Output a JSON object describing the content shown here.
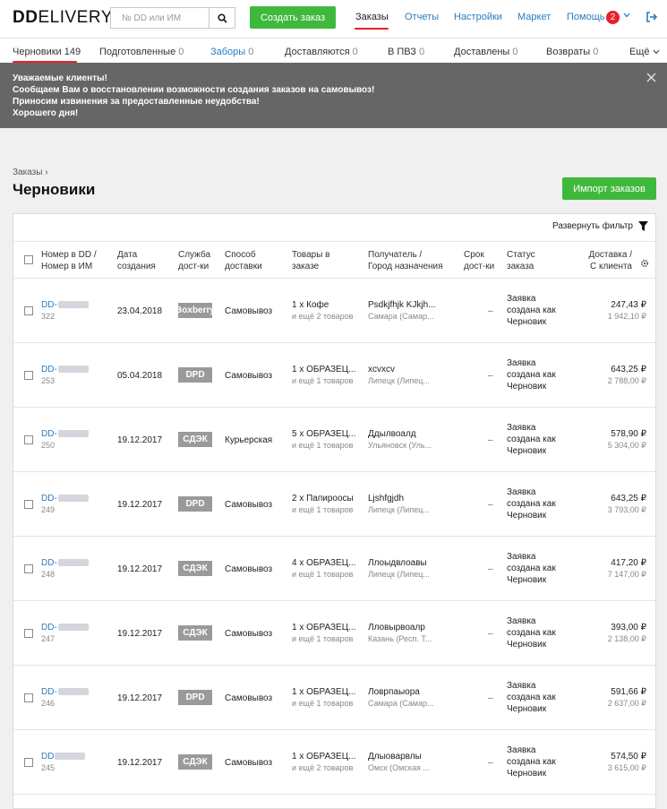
{
  "header": {
    "logo_bold": "DD",
    "logo_rest": "ELIVERY",
    "search_placeholder": "№ DD или ИМ",
    "create_label": "Создать заказ",
    "nav": [
      {
        "label": "Заказы",
        "active": true
      },
      {
        "label": "Отчеты"
      },
      {
        "label": "Настройки"
      },
      {
        "label": "Маркет"
      },
      {
        "label": "Помощь"
      }
    ],
    "help_badge": "2",
    "accent": "#3fb93c",
    "alert_color": "#e8202a",
    "link_color": "#2a7dbf"
  },
  "status_tabs": [
    {
      "label": "Черновики",
      "count": "149"
    },
    {
      "label": "Подготовленные",
      "count": "0"
    },
    {
      "label": "Заборы",
      "count": "0"
    },
    {
      "label": "Доставляются",
      "count": "0"
    },
    {
      "label": "В ПВЗ",
      "count": "0"
    },
    {
      "label": "Доставлены",
      "count": "0"
    },
    {
      "label": "Возвраты",
      "count": "0"
    },
    {
      "label": "Ещё",
      "count": ""
    }
  ],
  "banner": {
    "lines": [
      "Уважаемые клиенты!",
      "Сообщаем Вам о восстановлении возможности создания заказов на самовывоз!",
      "Приносим извинения за предоставленные неудобства!",
      "Хорошего дня!"
    ]
  },
  "page": {
    "breadcrumb": "Заказы",
    "title": "Черновики",
    "import_label": "Импорт заказов",
    "filter_label": "Развернуть фильтр"
  },
  "table": {
    "columns": [
      "Номер в DD /\nНомер в ИМ",
      "Дата\nсоздания",
      "Служба\nдост-ки",
      "Способ\nдоставки",
      "Товары в\nзаказе",
      "Получатель /\nГород назначения",
      "Срок\nдост-ки",
      "Статус\nзаказа",
      "Доставка /\nС клиента"
    ],
    "rows": [
      {
        "dd": "DD-",
        "im": "322",
        "date": "23.04.2018",
        "service": "Boxberry",
        "method": "Самовывоз",
        "goods": "1 x Кофе",
        "goods_more": "и ещё 2 товаров",
        "recipient": "Psdkjfhjk KJkjh...",
        "city": "Самара (Самар...",
        "term": "–",
        "status": "Заявка\nсоздана как\nЧерновик",
        "delivery": "247,43 ₽",
        "client": "1 942,10 ₽"
      },
      {
        "dd": "DD-",
        "im": "253",
        "date": "05.04.2018",
        "service": "DPD",
        "method": "Самовывоз",
        "goods": "1 x ОБРАЗЕЦ...",
        "goods_more": "и ещё 1 товаров",
        "recipient": "xcvxcv",
        "city": "Липецк (Липец...",
        "term": "–",
        "status": "Заявка\nсоздана как\nЧерновик",
        "delivery": "643,25 ₽",
        "client": "2 788,00 ₽"
      },
      {
        "dd": "DD-",
        "im": "250",
        "date": "19.12.2017",
        "service": "СДЭК",
        "method": "Курьерская",
        "goods": "5 x ОБРАЗЕЦ...",
        "goods_more": "и ещё 1 товаров",
        "recipient": "Ддылвоалд",
        "city": "Ульяновск (Уль...",
        "term": "–",
        "status": "Заявка\nсоздана как\nЧерновик",
        "delivery": "578,90 ₽",
        "client": "5 304,00 ₽"
      },
      {
        "dd": "DD-",
        "im": "249",
        "date": "19.12.2017",
        "service": "DPD",
        "method": "Самовывоз",
        "goods": "2 x Папироосы",
        "goods_more": "и ещё 1 товаров",
        "recipient": "Ljshfgjdh",
        "city": "Липецк (Липец...",
        "term": "–",
        "status": "Заявка\nсоздана как\nЧерновик",
        "delivery": "643,25 ₽",
        "client": "3 793,00 ₽"
      },
      {
        "dd": "DD-",
        "im": "248",
        "date": "19.12.2017",
        "service": "СДЭК",
        "method": "Самовывоз",
        "goods": "4 x ОБРАЗЕЦ...",
        "goods_more": "и ещё 1 товаров",
        "recipient": "Ллоыдвлоавы",
        "city": "Липецк (Липец...",
        "term": "–",
        "status": "Заявка\nсоздана как\nЧерновик",
        "delivery": "417,20 ₽",
        "client": "7 147,00 ₽"
      },
      {
        "dd": "DD-",
        "im": "247",
        "date": "19.12.2017",
        "service": "СДЭК",
        "method": "Самовывоз",
        "goods": "1 x ОБРАЗЕЦ...",
        "goods_more": "и ещё 1 товаров",
        "recipient": "Лловырвоалр",
        "city": "Казань (Респ. Т...",
        "term": "–",
        "status": "Заявка\nсоздана как\nЧерновик",
        "delivery": "393,00 ₽",
        "client": "2 138,00 ₽"
      },
      {
        "dd": "DD-",
        "im": "246",
        "date": "19.12.2017",
        "service": "DPD",
        "method": "Самовывоз",
        "goods": "1 x ОБРАЗЕЦ...",
        "goods_more": "и ещё 1 товаров",
        "recipient": "Ловрпаыора",
        "city": "Самара (Самар...",
        "term": "–",
        "status": "Заявка\nсоздана как\nЧерновик",
        "delivery": "591,66 ₽",
        "client": "2 637,00 ₽"
      },
      {
        "dd": "DD",
        "im": "245",
        "date": "19.12.2017",
        "service": "СДЭК",
        "method": "Самовывоз",
        "goods": "1 x ОБРАЗЕЦ...",
        "goods_more": "и ещё 2 товаров",
        "recipient": "Длыоварвлы",
        "city": "Омск (Омская ...",
        "term": "–",
        "status": "Заявка\nсоздана как\nЧерновик",
        "delivery": "574,50 ₽",
        "client": "3 615,00 ₽"
      }
    ]
  }
}
